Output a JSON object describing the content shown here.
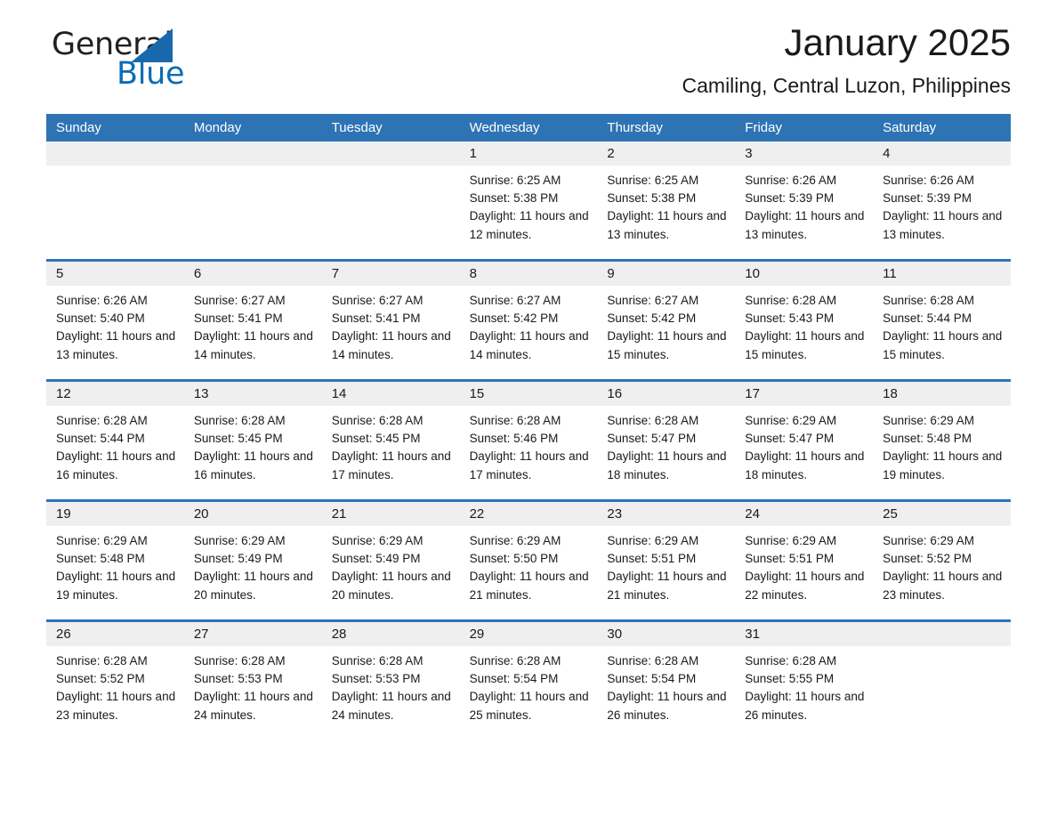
{
  "brand": {
    "name_part1": "General",
    "name_part2": "Blue",
    "logo_icon": "triangle-logo-icon",
    "colors": {
      "blue": "#1769ac",
      "text": "#231f20"
    }
  },
  "header": {
    "month_title": "January 2025",
    "location": "Camiling, Central Luzon, Philippines"
  },
  "theme": {
    "header_blue": "#2e74b5",
    "day_band_gray": "#efefef",
    "page_background": "#ffffff",
    "text": "#1a1a1a"
  },
  "calendar": {
    "weekdays": [
      "Sunday",
      "Monday",
      "Tuesday",
      "Wednesday",
      "Thursday",
      "Friday",
      "Saturday"
    ],
    "weeks": [
      [
        {
          "day": "",
          "empty": true
        },
        {
          "day": "",
          "empty": true
        },
        {
          "day": "",
          "empty": true
        },
        {
          "day": "1",
          "sunrise": "Sunrise: 6:25 AM",
          "sunset": "Sunset: 5:38 PM",
          "daylight": "Daylight: 11 hours and 12 minutes."
        },
        {
          "day": "2",
          "sunrise": "Sunrise: 6:25 AM",
          "sunset": "Sunset: 5:38 PM",
          "daylight": "Daylight: 11 hours and 13 minutes."
        },
        {
          "day": "3",
          "sunrise": "Sunrise: 6:26 AM",
          "sunset": "Sunset: 5:39 PM",
          "daylight": "Daylight: 11 hours and 13 minutes."
        },
        {
          "day": "4",
          "sunrise": "Sunrise: 6:26 AM",
          "sunset": "Sunset: 5:39 PM",
          "daylight": "Daylight: 11 hours and 13 minutes."
        }
      ],
      [
        {
          "day": "5",
          "sunrise": "Sunrise: 6:26 AM",
          "sunset": "Sunset: 5:40 PM",
          "daylight": "Daylight: 11 hours and 13 minutes."
        },
        {
          "day": "6",
          "sunrise": "Sunrise: 6:27 AM",
          "sunset": "Sunset: 5:41 PM",
          "daylight": "Daylight: 11 hours and 14 minutes."
        },
        {
          "day": "7",
          "sunrise": "Sunrise: 6:27 AM",
          "sunset": "Sunset: 5:41 PM",
          "daylight": "Daylight: 11 hours and 14 minutes."
        },
        {
          "day": "8",
          "sunrise": "Sunrise: 6:27 AM",
          "sunset": "Sunset: 5:42 PM",
          "daylight": "Daylight: 11 hours and 14 minutes."
        },
        {
          "day": "9",
          "sunrise": "Sunrise: 6:27 AM",
          "sunset": "Sunset: 5:42 PM",
          "daylight": "Daylight: 11 hours and 15 minutes."
        },
        {
          "day": "10",
          "sunrise": "Sunrise: 6:28 AM",
          "sunset": "Sunset: 5:43 PM",
          "daylight": "Daylight: 11 hours and 15 minutes."
        },
        {
          "day": "11",
          "sunrise": "Sunrise: 6:28 AM",
          "sunset": "Sunset: 5:44 PM",
          "daylight": "Daylight: 11 hours and 15 minutes."
        }
      ],
      [
        {
          "day": "12",
          "sunrise": "Sunrise: 6:28 AM",
          "sunset": "Sunset: 5:44 PM",
          "daylight": "Daylight: 11 hours and 16 minutes."
        },
        {
          "day": "13",
          "sunrise": "Sunrise: 6:28 AM",
          "sunset": "Sunset: 5:45 PM",
          "daylight": "Daylight: 11 hours and 16 minutes."
        },
        {
          "day": "14",
          "sunrise": "Sunrise: 6:28 AM",
          "sunset": "Sunset: 5:45 PM",
          "daylight": "Daylight: 11 hours and 17 minutes."
        },
        {
          "day": "15",
          "sunrise": "Sunrise: 6:28 AM",
          "sunset": "Sunset: 5:46 PM",
          "daylight": "Daylight: 11 hours and 17 minutes."
        },
        {
          "day": "16",
          "sunrise": "Sunrise: 6:28 AM",
          "sunset": "Sunset: 5:47 PM",
          "daylight": "Daylight: 11 hours and 18 minutes."
        },
        {
          "day": "17",
          "sunrise": "Sunrise: 6:29 AM",
          "sunset": "Sunset: 5:47 PM",
          "daylight": "Daylight: 11 hours and 18 minutes."
        },
        {
          "day": "18",
          "sunrise": "Sunrise: 6:29 AM",
          "sunset": "Sunset: 5:48 PM",
          "daylight": "Daylight: 11 hours and 19 minutes."
        }
      ],
      [
        {
          "day": "19",
          "sunrise": "Sunrise: 6:29 AM",
          "sunset": "Sunset: 5:48 PM",
          "daylight": "Daylight: 11 hours and 19 minutes."
        },
        {
          "day": "20",
          "sunrise": "Sunrise: 6:29 AM",
          "sunset": "Sunset: 5:49 PM",
          "daylight": "Daylight: 11 hours and 20 minutes."
        },
        {
          "day": "21",
          "sunrise": "Sunrise: 6:29 AM",
          "sunset": "Sunset: 5:49 PM",
          "daylight": "Daylight: 11 hours and 20 minutes."
        },
        {
          "day": "22",
          "sunrise": "Sunrise: 6:29 AM",
          "sunset": "Sunset: 5:50 PM",
          "daylight": "Daylight: 11 hours and 21 minutes."
        },
        {
          "day": "23",
          "sunrise": "Sunrise: 6:29 AM",
          "sunset": "Sunset: 5:51 PM",
          "daylight": "Daylight: 11 hours and 21 minutes."
        },
        {
          "day": "24",
          "sunrise": "Sunrise: 6:29 AM",
          "sunset": "Sunset: 5:51 PM",
          "daylight": "Daylight: 11 hours and 22 minutes."
        },
        {
          "day": "25",
          "sunrise": "Sunrise: 6:29 AM",
          "sunset": "Sunset: 5:52 PM",
          "daylight": "Daylight: 11 hours and 23 minutes."
        }
      ],
      [
        {
          "day": "26",
          "sunrise": "Sunrise: 6:28 AM",
          "sunset": "Sunset: 5:52 PM",
          "daylight": "Daylight: 11 hours and 23 minutes."
        },
        {
          "day": "27",
          "sunrise": "Sunrise: 6:28 AM",
          "sunset": "Sunset: 5:53 PM",
          "daylight": "Daylight: 11 hours and 24 minutes."
        },
        {
          "day": "28",
          "sunrise": "Sunrise: 6:28 AM",
          "sunset": "Sunset: 5:53 PM",
          "daylight": "Daylight: 11 hours and 24 minutes."
        },
        {
          "day": "29",
          "sunrise": "Sunrise: 6:28 AM",
          "sunset": "Sunset: 5:54 PM",
          "daylight": "Daylight: 11 hours and 25 minutes."
        },
        {
          "day": "30",
          "sunrise": "Sunrise: 6:28 AM",
          "sunset": "Sunset: 5:54 PM",
          "daylight": "Daylight: 11 hours and 26 minutes."
        },
        {
          "day": "31",
          "sunrise": "Sunrise: 6:28 AM",
          "sunset": "Sunset: 5:55 PM",
          "daylight": "Daylight: 11 hours and 26 minutes."
        },
        {
          "day": "",
          "empty": true
        }
      ]
    ]
  }
}
